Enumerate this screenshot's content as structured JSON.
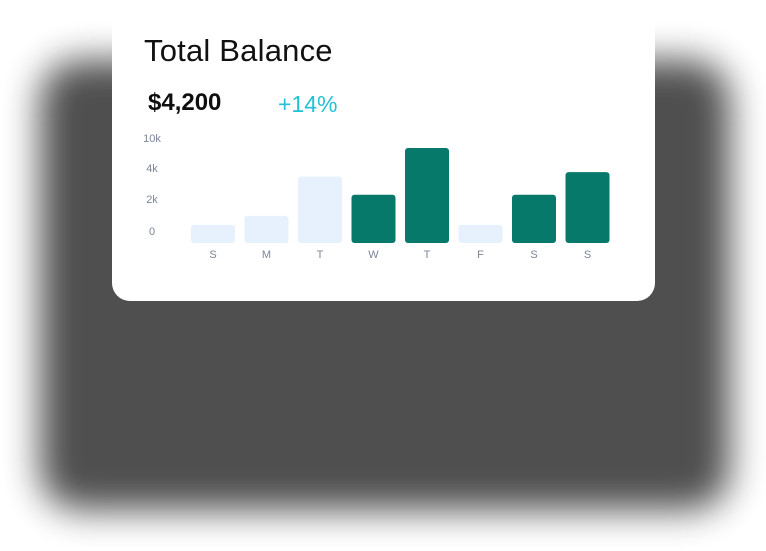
{
  "card": {
    "title": "Total Balance",
    "amount": "$4,200",
    "change": "+14%"
  },
  "chart_data": {
    "type": "bar",
    "y_ticks": [
      "10k",
      "4k",
      "2k",
      "0"
    ],
    "categories": [
      "S",
      "M",
      "T",
      "W",
      "T",
      "F",
      "S",
      "S"
    ],
    "values": [
      1.2,
      1.8,
      4.4,
      3.2,
      6.3,
      1.2,
      3.2,
      4.7
    ],
    "highlighted": [
      false,
      false,
      false,
      true,
      true,
      false,
      true,
      true
    ],
    "colors": {
      "light_bar": "#e6f1fd",
      "dark_bar": "#06796a",
      "tick_label": "#7d8598",
      "change_text": "#22c1d6"
    },
    "ylim": [
      0,
      6.3
    ]
  }
}
